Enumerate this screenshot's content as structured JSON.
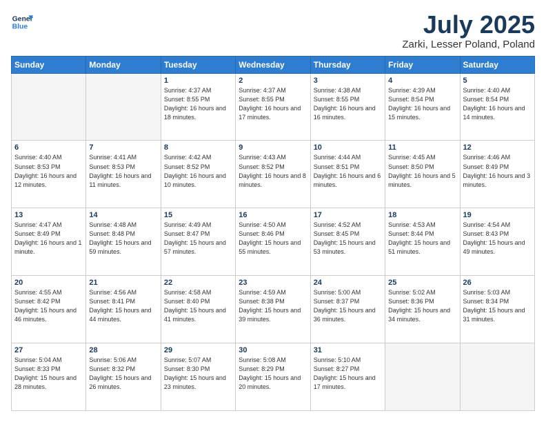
{
  "header": {
    "logo_line1": "General",
    "logo_line2": "Blue",
    "month": "July 2025",
    "location": "Zarki, Lesser Poland, Poland"
  },
  "weekdays": [
    "Sunday",
    "Monday",
    "Tuesday",
    "Wednesday",
    "Thursday",
    "Friday",
    "Saturday"
  ],
  "weeks": [
    [
      {
        "day": "",
        "info": ""
      },
      {
        "day": "",
        "info": ""
      },
      {
        "day": "1",
        "info": "Sunrise: 4:37 AM\nSunset: 8:55 PM\nDaylight: 16 hours and 18 minutes."
      },
      {
        "day": "2",
        "info": "Sunrise: 4:37 AM\nSunset: 8:55 PM\nDaylight: 16 hours and 17 minutes."
      },
      {
        "day": "3",
        "info": "Sunrise: 4:38 AM\nSunset: 8:55 PM\nDaylight: 16 hours and 16 minutes."
      },
      {
        "day": "4",
        "info": "Sunrise: 4:39 AM\nSunset: 8:54 PM\nDaylight: 16 hours and 15 minutes."
      },
      {
        "day": "5",
        "info": "Sunrise: 4:40 AM\nSunset: 8:54 PM\nDaylight: 16 hours and 14 minutes."
      }
    ],
    [
      {
        "day": "6",
        "info": "Sunrise: 4:40 AM\nSunset: 8:53 PM\nDaylight: 16 hours and 12 minutes."
      },
      {
        "day": "7",
        "info": "Sunrise: 4:41 AM\nSunset: 8:53 PM\nDaylight: 16 hours and 11 minutes."
      },
      {
        "day": "8",
        "info": "Sunrise: 4:42 AM\nSunset: 8:52 PM\nDaylight: 16 hours and 10 minutes."
      },
      {
        "day": "9",
        "info": "Sunrise: 4:43 AM\nSunset: 8:52 PM\nDaylight: 16 hours and 8 minutes."
      },
      {
        "day": "10",
        "info": "Sunrise: 4:44 AM\nSunset: 8:51 PM\nDaylight: 16 hours and 6 minutes."
      },
      {
        "day": "11",
        "info": "Sunrise: 4:45 AM\nSunset: 8:50 PM\nDaylight: 16 hours and 5 minutes."
      },
      {
        "day": "12",
        "info": "Sunrise: 4:46 AM\nSunset: 8:49 PM\nDaylight: 16 hours and 3 minutes."
      }
    ],
    [
      {
        "day": "13",
        "info": "Sunrise: 4:47 AM\nSunset: 8:49 PM\nDaylight: 16 hours and 1 minute."
      },
      {
        "day": "14",
        "info": "Sunrise: 4:48 AM\nSunset: 8:48 PM\nDaylight: 15 hours and 59 minutes."
      },
      {
        "day": "15",
        "info": "Sunrise: 4:49 AM\nSunset: 8:47 PM\nDaylight: 15 hours and 57 minutes."
      },
      {
        "day": "16",
        "info": "Sunrise: 4:50 AM\nSunset: 8:46 PM\nDaylight: 15 hours and 55 minutes."
      },
      {
        "day": "17",
        "info": "Sunrise: 4:52 AM\nSunset: 8:45 PM\nDaylight: 15 hours and 53 minutes."
      },
      {
        "day": "18",
        "info": "Sunrise: 4:53 AM\nSunset: 8:44 PM\nDaylight: 15 hours and 51 minutes."
      },
      {
        "day": "19",
        "info": "Sunrise: 4:54 AM\nSunset: 8:43 PM\nDaylight: 15 hours and 49 minutes."
      }
    ],
    [
      {
        "day": "20",
        "info": "Sunrise: 4:55 AM\nSunset: 8:42 PM\nDaylight: 15 hours and 46 minutes."
      },
      {
        "day": "21",
        "info": "Sunrise: 4:56 AM\nSunset: 8:41 PM\nDaylight: 15 hours and 44 minutes."
      },
      {
        "day": "22",
        "info": "Sunrise: 4:58 AM\nSunset: 8:40 PM\nDaylight: 15 hours and 41 minutes."
      },
      {
        "day": "23",
        "info": "Sunrise: 4:59 AM\nSunset: 8:38 PM\nDaylight: 15 hours and 39 minutes."
      },
      {
        "day": "24",
        "info": "Sunrise: 5:00 AM\nSunset: 8:37 PM\nDaylight: 15 hours and 36 minutes."
      },
      {
        "day": "25",
        "info": "Sunrise: 5:02 AM\nSunset: 8:36 PM\nDaylight: 15 hours and 34 minutes."
      },
      {
        "day": "26",
        "info": "Sunrise: 5:03 AM\nSunset: 8:34 PM\nDaylight: 15 hours and 31 minutes."
      }
    ],
    [
      {
        "day": "27",
        "info": "Sunrise: 5:04 AM\nSunset: 8:33 PM\nDaylight: 15 hours and 28 minutes."
      },
      {
        "day": "28",
        "info": "Sunrise: 5:06 AM\nSunset: 8:32 PM\nDaylight: 15 hours and 26 minutes."
      },
      {
        "day": "29",
        "info": "Sunrise: 5:07 AM\nSunset: 8:30 PM\nDaylight: 15 hours and 23 minutes."
      },
      {
        "day": "30",
        "info": "Sunrise: 5:08 AM\nSunset: 8:29 PM\nDaylight: 15 hours and 20 minutes."
      },
      {
        "day": "31",
        "info": "Sunrise: 5:10 AM\nSunset: 8:27 PM\nDaylight: 15 hours and 17 minutes."
      },
      {
        "day": "",
        "info": ""
      },
      {
        "day": "",
        "info": ""
      }
    ]
  ]
}
